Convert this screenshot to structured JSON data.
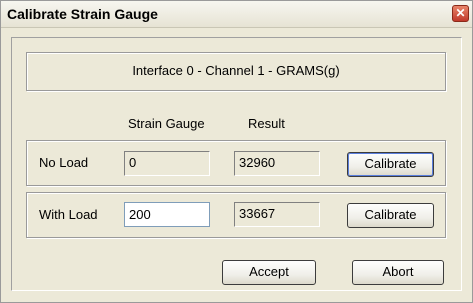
{
  "window": {
    "title": "Calibrate Strain Gauge"
  },
  "header": {
    "label": "Interface 0 - Channel 1 - GRAMS(g)"
  },
  "columns": {
    "strain_gauge": "Strain Gauge",
    "result": "Result"
  },
  "rows": [
    {
      "label": "No Load",
      "strain_gauge": "0",
      "result": "32960",
      "button": "Calibrate"
    },
    {
      "label": "With Load",
      "strain_gauge": "200",
      "result": "33667",
      "button": "Calibrate"
    }
  ],
  "footer": {
    "accept": "Accept",
    "abort": "Abort"
  }
}
